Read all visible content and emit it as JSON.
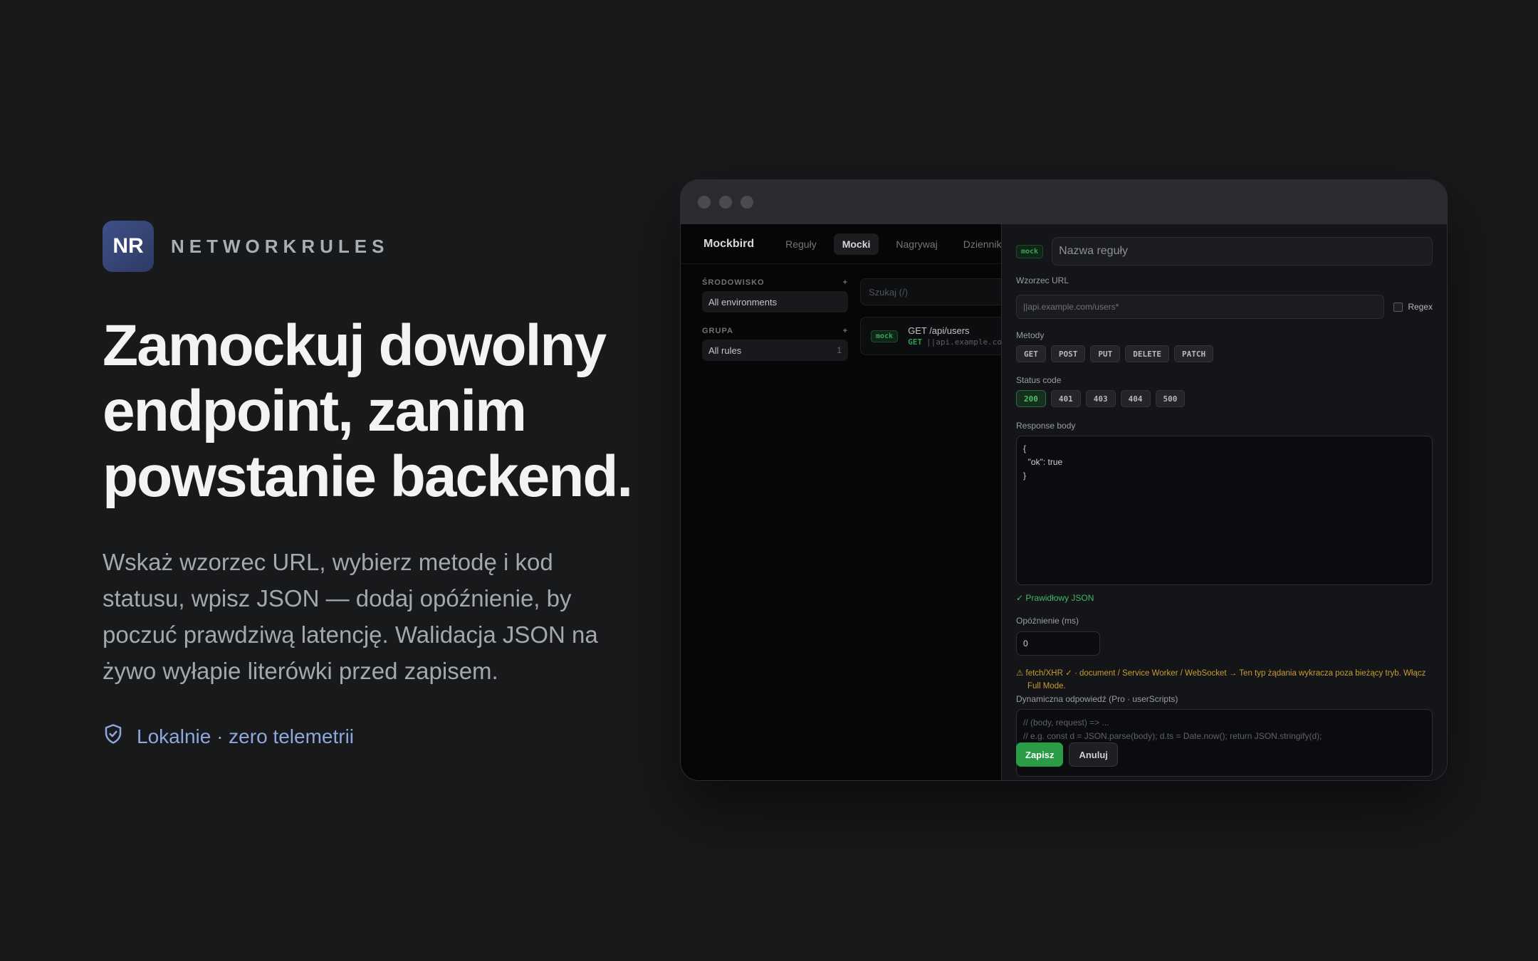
{
  "brand": {
    "logo": "NR",
    "name": "NETWORKRULES"
  },
  "hero": {
    "headline": "Zamockuj dowolny endpoint, zanim powstanie backend.",
    "lead": "Wskaż wzorzec URL, wybierz metodę i kod statusu, wpisz JSON — dodaj opóźnienie, by poczuć prawdziwą latencję. Walidacja JSON na żywo wyłapie literówki przed zapisem.",
    "privacy": "Lokalnie · zero telemetrii",
    "privacy_icon": "shield-check-icon",
    "accent_color": "#8fa7dd"
  },
  "app": {
    "name": "Mockbird",
    "tabs": [
      "Reguły",
      "Mocki",
      "Nagrywaj",
      "Dziennik do"
    ],
    "active_tab": "Mocki",
    "sidebar": {
      "environment_title": "ŚRODOWISKO",
      "environment_item": "All environments",
      "group_title": "GRUPA",
      "group_item": "All rules",
      "group_count": "1",
      "add_symbol": "+"
    },
    "search_placeholder": "Szukaj  (/)",
    "rule": {
      "tag": "mock",
      "title": "GET /api/users",
      "method": "GET",
      "url": "||api.example.co"
    }
  },
  "editor": {
    "tag": "mock",
    "name_placeholder": "Nazwa reguły",
    "url_label": "Wzorzec URL",
    "url_placeholder": "||api.example.com/users*",
    "regex_label": "Regex",
    "methods_label": "Metody",
    "methods": [
      "GET",
      "POST",
      "PUT",
      "DELETE",
      "PATCH"
    ],
    "status_label": "Status code",
    "statuses": [
      "200",
      "401",
      "403",
      "404",
      "500"
    ],
    "selected_status": "200",
    "body_label": "Response body",
    "body_value": "{\n  \"ok\": true\n}",
    "valid_text": "✓ Prawidłowy JSON",
    "delay_label": "Opóźnienie (ms)",
    "delay_value": "0",
    "warning": "⚠ fetch/XHR ✓ · document / Service Worker / WebSocket → Ten typ żądania wykracza poza bieżący tryb. Włącz Full Mode.",
    "dynamic_label": "Dynamiczna odpowiedź (Pro · userScripts)",
    "dynamic_line1": "// (body, request) => ...",
    "dynamic_line2": "// e.g. const d = JSON.parse(body); d.ts = Date.now(); return JSON.stringify(d);",
    "save_label": "Zapisz",
    "cancel_label": "Anuluj",
    "success_color": "#2a9b46",
    "warning_color": "#c99b2e"
  }
}
